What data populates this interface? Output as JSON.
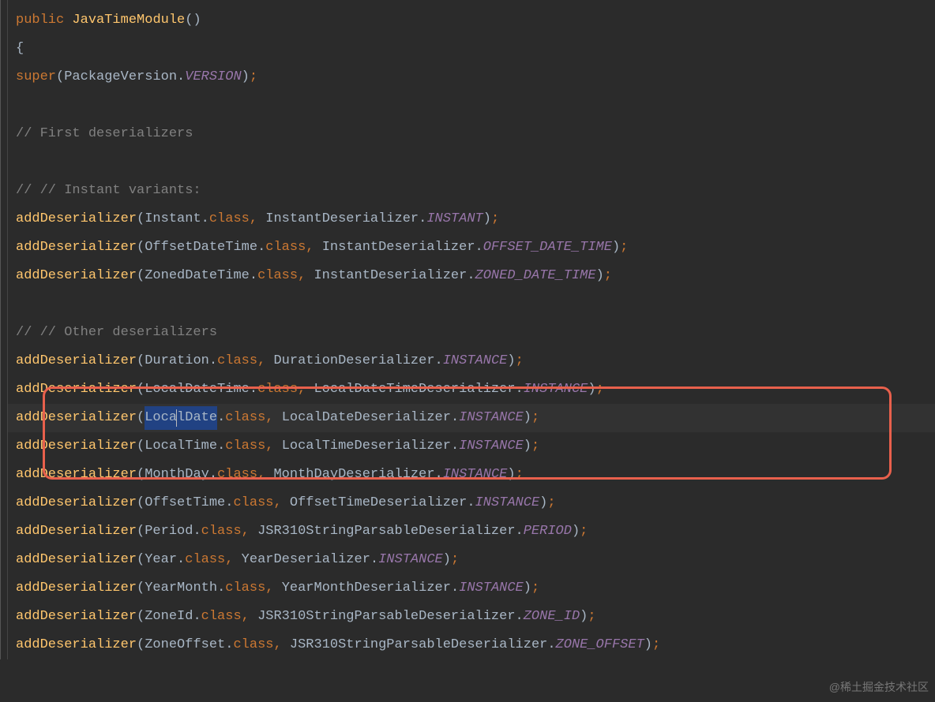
{
  "code": {
    "l1_public": "public",
    "l1_method": "JavaTimeModule",
    "l1_parens": "()",
    "l2_brace": "{",
    "l3_super": "super",
    "l3_pkg": "PackageVersion",
    "l3_const": "VERSION",
    "c1": "// First deserializers",
    "c2": "// // Instant variants:",
    "add": "addDeserializer",
    "instant": "Instant",
    "offsetDateTime": "OffsetDateTime",
    "zonedDateTime": "ZonedDateTime",
    "instantDeser": "InstantDeserializer",
    "const_instant": "INSTANT",
    "const_odt": "OFFSET_DATE_TIME",
    "const_zdt": "ZONED_DATE_TIME",
    "c3": "// // Other deserializers",
    "duration": "Duration",
    "durationDeser": "DurationDeserializer",
    "localDateTime": "LocalDateTime",
    "localDateTimeDeser": "LocalDateTimeDeserializer",
    "localDate_a": "Loca",
    "localDate_b": "lDate",
    "localDateDeser": "LocalDateDeserializer",
    "localTime": "LocalTime",
    "localTimeDeser": "LocalTimeDeserializer",
    "instance": "INSTANCE",
    "monthDay": "MonthDay",
    "monthDayDeser": "MonthDayDeserializer",
    "offsetTime": "OffsetTime",
    "offsetTimeDeser": "OffsetTimeDeserializer",
    "period": "Period",
    "jsr310": "JSR310StringParsableDeserializer",
    "const_period": "PERIOD",
    "year": "Year",
    "yearDeser": "YearDeserializer",
    "yearMonth": "YearMonth",
    "yearMonthDeser": "YearMonthDeserializer",
    "zoneId": "ZoneId",
    "const_zoneId": "ZONE_ID",
    "zoneOffset": "ZoneOffset",
    "const_zoneOffset": "ZONE_OFFSET",
    "dot": ".",
    "class_kw": "class",
    "comma_sp": ", ",
    "lp": "(",
    "rp": ")",
    "semi": ";"
  },
  "watermark": "@稀土掘金技术社区",
  "colors": {
    "highlight_border": "#e8604c",
    "keyword": "#cc7832",
    "method": "#ffc66d",
    "constant": "#9876aa",
    "comment": "#808080",
    "text": "#a9b7c6",
    "bg": "#2b2b2b"
  }
}
